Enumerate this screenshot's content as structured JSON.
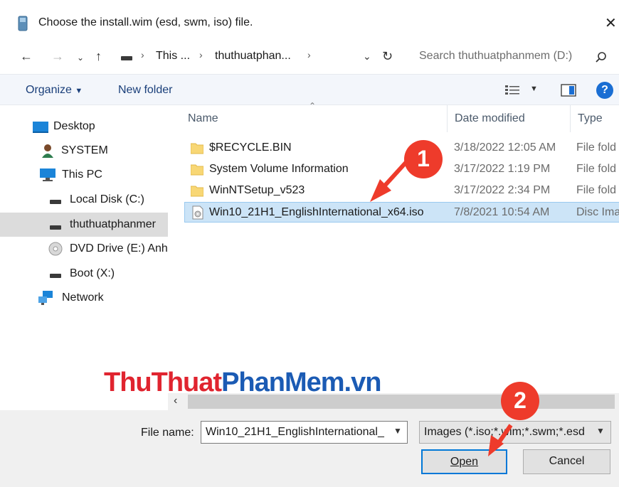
{
  "window": {
    "title": "Choose the install.wim (esd, swm, iso) file.",
    "close_glyph": "✕"
  },
  "address": {
    "crumbs": [
      "This ...",
      "thuthuatphan..."
    ],
    "search_placeholder": "Search thuthuatphanmem (D:)"
  },
  "toolbar": {
    "organize_label": "Organize",
    "new_folder_label": "New folder",
    "help_glyph": "?"
  },
  "navpane": {
    "items": [
      {
        "label": "Desktop",
        "icon": "desktop-icon"
      },
      {
        "label": "SYSTEM",
        "icon": "user-icon"
      },
      {
        "label": "This PC",
        "icon": "computer-icon"
      },
      {
        "label": "Local Disk (C:)",
        "icon": "drive-icon"
      },
      {
        "label": "thuthuatphanmer",
        "icon": "drive-icon",
        "selected": true
      },
      {
        "label": "DVD Drive (E:) Anh",
        "icon": "dvd-icon"
      },
      {
        "label": "Boot (X:)",
        "icon": "drive-icon"
      },
      {
        "label": "Network",
        "icon": "network-icon"
      }
    ]
  },
  "columns": {
    "name": "Name",
    "date_modified": "Date modified",
    "type": "Type"
  },
  "files": [
    {
      "name": "$RECYCLE.BIN",
      "date": "3/18/2022 12:05 AM",
      "type": "File fold",
      "icon": "folder-icon"
    },
    {
      "name": "System Volume Information",
      "date": "3/17/2022 1:19 PM",
      "type": "File fold",
      "icon": "folder-icon"
    },
    {
      "name": "WinNTSetup_v523",
      "date": "3/17/2022 2:34 PM",
      "type": "File fold",
      "icon": "folder-icon"
    },
    {
      "name": "Win10_21H1_EnglishInternational_x64.iso",
      "date": "7/8/2021 10:54 AM",
      "type": "Disc Ima",
      "icon": "disc-image-icon",
      "selected": true
    }
  ],
  "footer": {
    "file_name_label": "File name:",
    "file_name_value": "Win10_21H1_EnglishInternational_",
    "file_type_value": "Images (*.iso;*.wim;*.swm;*.esd",
    "open_label": "Open",
    "cancel_label": "Cancel"
  },
  "watermark": {
    "part1": "ThuThuat",
    "part2": "PhanMem.vn"
  },
  "callouts": [
    "1",
    "2"
  ],
  "colors": {
    "accent": "#0078d7",
    "selection": "#cce4f7",
    "callout": "#ee3b2b",
    "watermark_red": "#e0242f",
    "watermark_blue": "#1b5bb4"
  }
}
